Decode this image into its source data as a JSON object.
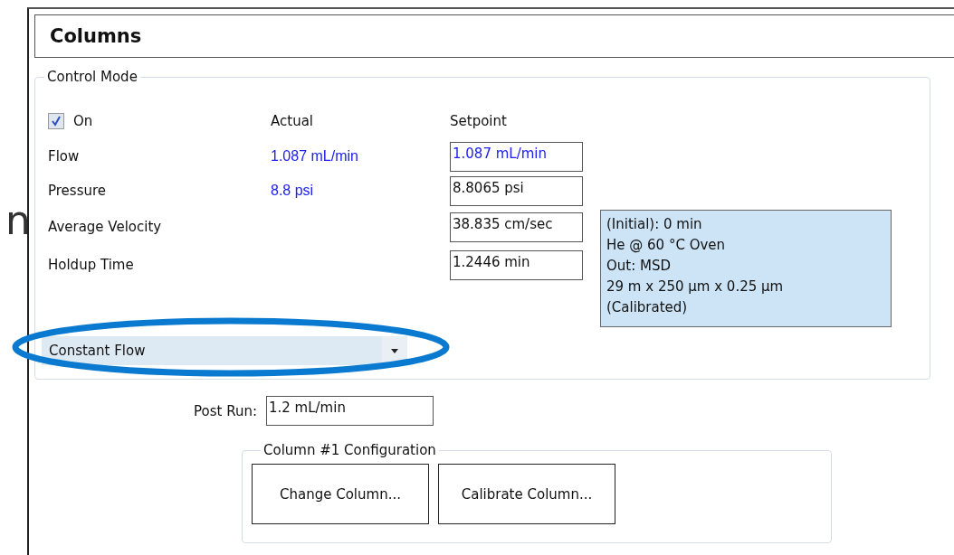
{
  "edge_text": "n",
  "title": "Columns",
  "control_mode": {
    "legend": "Control Mode",
    "on": {
      "label": "On",
      "checked": true
    },
    "headers": {
      "actual": "Actual",
      "setpoint": "Setpoint"
    },
    "rows": [
      {
        "label": "Flow",
        "actual": "1.087 mL/min",
        "setpoint": "1.087 mL/min",
        "setpoint_highlighted": true
      },
      {
        "label": "Pressure",
        "actual": "8.8 psi",
        "setpoint": "8.8065 psi",
        "setpoint_highlighted": false
      },
      {
        "label": "Average Velocity",
        "setpoint": "38.835 cm/sec",
        "setpoint_highlighted": false
      },
      {
        "label": "Holdup Time",
        "setpoint": "1.2446 min",
        "setpoint_highlighted": false
      }
    ],
    "info_lines": [
      "(Initial): 0 min",
      "He @ 60 °C Oven",
      "Out: MSD",
      "29 m x 250 µm x 0.25 µm",
      "(Calibrated)"
    ],
    "mode_dropdown": {
      "value": "Constant Flow",
      "annotated": true
    }
  },
  "post_run": {
    "label": "Post Run:",
    "value": "1.2 mL/min"
  },
  "configuration": {
    "legend": "Column #1 Configuration",
    "buttons": [
      "Change Column...",
      "Calibrate Column..."
    ]
  }
}
